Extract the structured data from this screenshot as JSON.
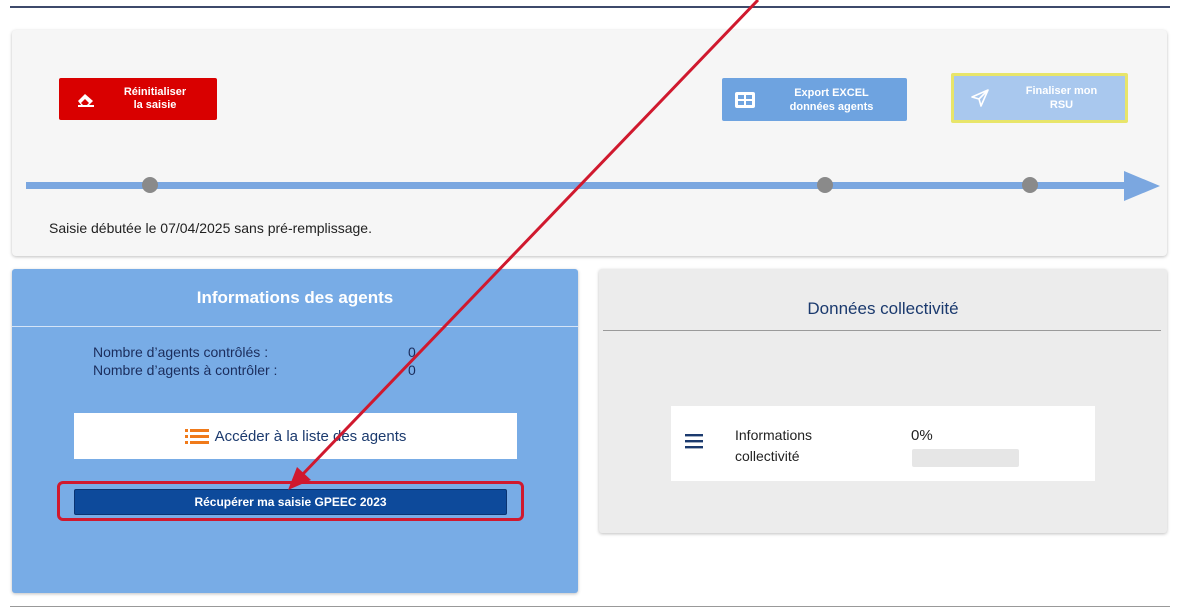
{
  "timeline": {
    "reset_button": "Réinitialiser\nla saisie",
    "export_button": "Export EXCEL\ndonnées agents",
    "finalize_button": "Finaliser mon\nRSU",
    "status": "Saisie débutée le 07/04/2025 sans pré-remplissage."
  },
  "agents": {
    "title": "Informations des agents",
    "stats": [
      {
        "label": "Nombre d’agents contrôlés :",
        "value": "0"
      },
      {
        "label": "Nombre d’agents à contrôler :",
        "value": "0"
      }
    ],
    "list_button": "Accéder à la liste des agents",
    "recover_button": "Récupérer ma saisie GPEEC 2023"
  },
  "collectivite": {
    "title": "Données collectivité",
    "item_label": "Informations\ncollectivité",
    "item_percent": "0%",
    "item_progress": 0
  },
  "colors": {
    "accent_blue": "#78ace6",
    "reset_red": "#d90000",
    "primary_dark": "#0d4a9b",
    "annotation_red": "#d0192e",
    "highlight_yellow": "#e8e56a"
  },
  "icons": [
    "eraser-icon",
    "table-icon",
    "send-icon",
    "list-icon",
    "menu-icon"
  ]
}
